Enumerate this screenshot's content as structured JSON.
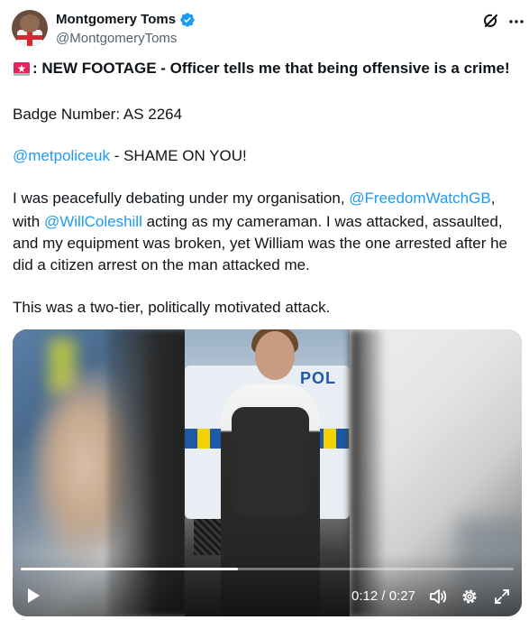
{
  "author": {
    "display_name": "Montgomery Toms",
    "handle": "@MontgomeryToms",
    "verified": true
  },
  "icons": {
    "verified": "verified-badge-icon",
    "grok": "grok-icon",
    "more": "more-icon",
    "siren": "rotating-light-icon",
    "play": "play-icon",
    "volume": "volume-icon",
    "settings": "settings-gear-icon",
    "expand": "fullscreen-expand-icon"
  },
  "post": {
    "headline": ": NEW FOOTAGE - Officer tells me that being offensive is a crime!",
    "badge_line": "Badge Number: AS 2264",
    "line3_mention": "@metpoliceuk",
    "line3_text": " - SHAME ON YOU!",
    "para1_a": "I was peacefully debating under my organisation, ",
    "para1_mention1": "@FreedomWatchGB",
    "para1_b": ",",
    "para2_a": "with ",
    "para2_mention2": "@WillColeshill",
    "para2_b": " acting as my cameraman. I was attacked, assaulted,",
    "para3": "and my equipment was broken, yet William was the one arrested after he",
    "para4": "did a citizen arrest on the man attacked me.",
    "closing": "This was a two-tier, politically motivated attack."
  },
  "video": {
    "current_time": "0:12",
    "separator": " / ",
    "duration": "0:27",
    "progress_fraction": 0.44,
    "van_marking": "POL"
  },
  "colors": {
    "link": "#1d9bf0",
    "verified": "#1d9bf0",
    "text": "#0f1419",
    "secondary": "#536471",
    "siren": "#e0245e"
  }
}
